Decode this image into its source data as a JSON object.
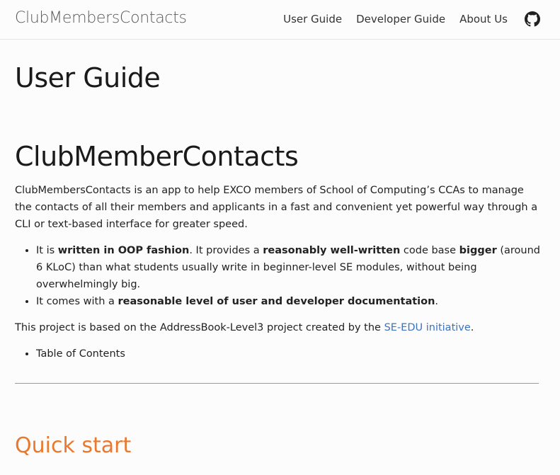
{
  "navbar": {
    "brand": "ClubMembersContacts",
    "links": [
      "User Guide",
      "Developer Guide",
      "About Us"
    ],
    "github_icon": "github-icon"
  },
  "page": {
    "title": "User Guide",
    "heading": "ClubMemberContacts",
    "intro": "ClubMembersContacts is an app to help EXCO members of School of Computing’s CCAs to manage the contacts of all their members and applicants in a fast and convenient yet powerful way through a CLI or text-based interface for greater speed.",
    "bullets": {
      "b1_pre": "It is ",
      "b1_bold1": "written in OOP fashion",
      "b1_mid1": ". It provides a ",
      "b1_bold2": "reasonably well-written",
      "b1_mid2": " code base ",
      "b1_bold3": "bigger",
      "b1_post": " (around 6 KLoC) than what students usually write in beginner-level SE modules, without being overwhelmingly big.",
      "b2_pre": "It comes with a ",
      "b2_bold": "reasonable level of user and developer documentation",
      "b2_post": "."
    },
    "based_pre": "This project is based on the AddressBook-Level3 project created by the ",
    "based_link": "SE-EDU initiative",
    "based_post": ".",
    "toc": "Table of Contents",
    "quick_start": "Quick start"
  },
  "colors": {
    "link": "#3a73c4",
    "heading_accent": "#e8792f"
  }
}
